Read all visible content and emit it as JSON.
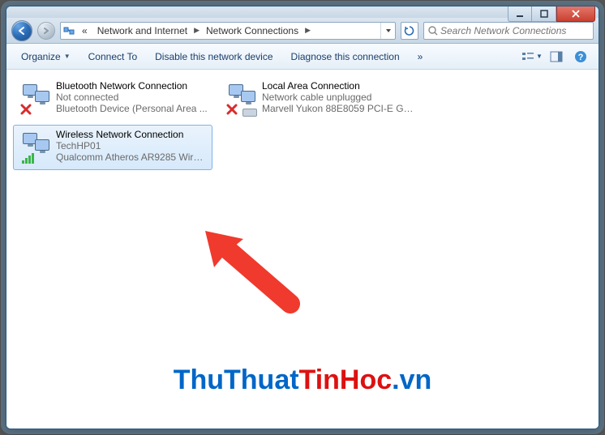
{
  "breadcrumb": {
    "prefix": "«",
    "parent": "Network and Internet",
    "current": "Network Connections"
  },
  "search": {
    "placeholder": "Search Network Connections"
  },
  "commands": {
    "organize": "Organize",
    "connect_to": "Connect To",
    "disable": "Disable this network device",
    "diagnose": "Diagnose this connection",
    "overflow": "»"
  },
  "connections": [
    {
      "name": "Bluetooth Network Connection",
      "status": "Not connected",
      "device": "Bluetooth Device (Personal Area ...",
      "overlay": "disabled"
    },
    {
      "name": "Local Area Connection",
      "status": "Network cable unplugged",
      "device": "Marvell Yukon 88E8059 PCI-E Gig...",
      "overlay": "unplugged"
    },
    {
      "name": "Wireless Network Connection",
      "status": "TechHP01",
      "device": "Qualcomm Atheros AR9285 Wirel...",
      "overlay": "signal",
      "selected": true
    }
  ],
  "watermark": {
    "part1": "ThuThuat",
    "part2": "TinHoc",
    "part3": ".vn"
  }
}
